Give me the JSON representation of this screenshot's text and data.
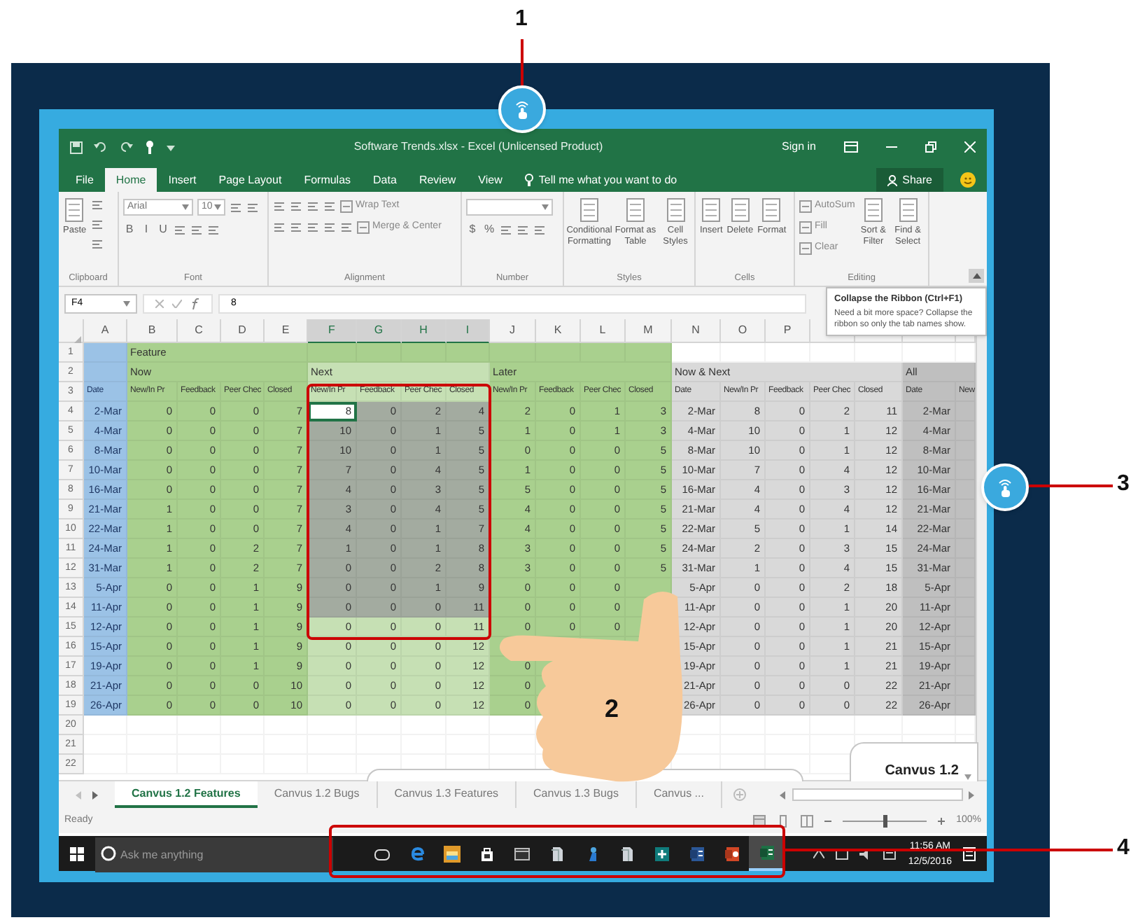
{
  "annotations": [
    {
      "label": "1",
      "kind": "button"
    },
    {
      "label": "2",
      "kind": "gesture"
    },
    {
      "label": "3",
      "kind": "button"
    },
    {
      "label": "4",
      "kind": "region"
    }
  ],
  "title_bar": {
    "title": "Software Trends.xlsx - Excel (Unlicensed Product)",
    "sign_in": "Sign in"
  },
  "ribbon_tabs": [
    {
      "label": "File",
      "selected": false
    },
    {
      "label": "Home",
      "selected": true
    },
    {
      "label": "Insert",
      "selected": false
    },
    {
      "label": "Page Layout",
      "selected": false
    },
    {
      "label": "Formulas",
      "selected": false
    },
    {
      "label": "Data",
      "selected": false
    },
    {
      "label": "Review",
      "selected": false
    },
    {
      "label": "View",
      "selected": false
    }
  ],
  "tell_me": "Tell me what you want to do",
  "share": "Share",
  "ribbon_groups": [
    {
      "label": "Clipboard",
      "items": [
        {
          "kind": "large",
          "label": "Paste"
        },
        {
          "kind": "stack",
          "lines": [
            {
              "items": [
                {
                  "kind": "icon"
                }
              ]
            },
            {
              "items": [
                {
                  "kind": "icon"
                }
              ]
            },
            {
              "items": [
                {
                  "kind": "icon"
                }
              ]
            }
          ]
        }
      ]
    },
    {
      "label": "Font",
      "items": [
        {
          "kind": "stack",
          "lines": [
            {
              "items": [
                {
                  "kind": "field",
                  "label": "Arial"
                },
                {
                  "kind": "field",
                  "label": "10"
                },
                {
                  "kind": "icon"
                },
                {
                  "kind": "icon"
                }
              ]
            },
            {
              "items": [
                {
                  "kind": "glyph",
                  "label": "B"
                },
                {
                  "kind": "glyph",
                  "label": "I"
                },
                {
                  "kind": "glyph",
                  "label": "U"
                },
                {
                  "kind": "icon"
                },
                {
                  "kind": "icon"
                },
                {
                  "kind": "icon"
                }
              ]
            }
          ]
        }
      ]
    },
    {
      "label": "Alignment",
      "items": [
        {
          "kind": "stack",
          "lines": [
            {
              "items": [
                {
                  "kind": "icon"
                },
                {
                  "kind": "icon"
                },
                {
                  "kind": "icon"
                },
                {
                  "kind": "icon"
                },
                {
                  "kind": "small",
                  "label": "Wrap Text"
                }
              ]
            },
            {
              "items": [
                {
                  "kind": "icon"
                },
                {
                  "kind": "icon"
                },
                {
                  "kind": "icon"
                },
                {
                  "kind": "icon"
                },
                {
                  "kind": "icon"
                },
                {
                  "kind": "small",
                  "label": "Merge & Center"
                }
              ]
            }
          ]
        }
      ]
    },
    {
      "label": "Number",
      "items": [
        {
          "kind": "stack",
          "lines": [
            {
              "items": [
                {
                  "kind": "field"
                }
              ]
            },
            {
              "items": [
                {
                  "kind": "glyph",
                  "label": "$"
                },
                {
                  "kind": "glyph",
                  "label": "%"
                },
                {
                  "kind": "icon"
                },
                {
                  "kind": "icon"
                },
                {
                  "kind": "icon"
                }
              ]
            }
          ]
        }
      ]
    },
    {
      "label": "Styles",
      "items": [
        {
          "kind": "large",
          "label": "Conditional Formatting"
        },
        {
          "kind": "large",
          "label": "Format as Table"
        },
        {
          "kind": "large",
          "label": "Cell Styles"
        }
      ]
    },
    {
      "label": "Cells",
      "items": [
        {
          "kind": "large",
          "label": "Insert"
        },
        {
          "kind": "large",
          "label": "Delete"
        },
        {
          "kind": "large",
          "label": "Format"
        }
      ]
    },
    {
      "label": "Editing",
      "items": [
        {
          "kind": "stack",
          "lines": [
            {
              "items": [
                {
                  "kind": "small",
                  "label": "AutoSum"
                }
              ]
            },
            {
              "items": [
                {
                  "kind": "small",
                  "label": "Fill"
                }
              ]
            },
            {
              "items": [
                {
                  "kind": "small",
                  "label": "Clear"
                }
              ]
            }
          ]
        },
        {
          "kind": "large",
          "label": "Sort & Filter"
        },
        {
          "kind": "large",
          "label": "Find & Select"
        }
      ]
    }
  ],
  "tooltip": {
    "title": "Collapse the Ribbon (Ctrl+F1)",
    "text": "Need a bit more space? Collapse the ribbon so only the tab names show."
  },
  "formula_bar": {
    "name_box": "F4",
    "value": "8"
  },
  "columns": [
    "A",
    "B",
    "C",
    "D",
    "E",
    "F",
    "G",
    "H",
    "I",
    "J",
    "K",
    "L",
    "M",
    "N",
    "O",
    "P",
    null,
    null,
    null,
    null
  ],
  "rows": [
    {
      "number": "1",
      "selected": false,
      "cells": [
        null,
        "Feature",
        null,
        null,
        null,
        null,
        null,
        null,
        null,
        null,
        null,
        null,
        null,
        null,
        null,
        null,
        null,
        null,
        null,
        null
      ]
    },
    {
      "number": "2",
      "selected": false,
      "cells": [
        null,
        "Now",
        null,
        null,
        null,
        "Next",
        null,
        null,
        null,
        "Later",
        null,
        null,
        null,
        "Now & Next",
        null,
        null,
        null,
        null,
        "All",
        null
      ]
    },
    {
      "number": "3",
      "selected": false,
      "cells": [
        "Date",
        "New/In Pr",
        "Feedback",
        "Peer Chec",
        "Closed",
        "New/In Pr",
        "Feedback",
        "Peer Chec",
        "Closed",
        "New/In Pr",
        "Feedback",
        "Peer Chec",
        "Closed",
        "Date",
        "New/In Pr",
        "Feedback",
        "Peer Chec",
        "Closed",
        "Date",
        "New"
      ]
    },
    {
      "number": "4",
      "selected": true,
      "cells": [
        "2-Mar",
        "0",
        "0",
        "0",
        "7",
        "8",
        "0",
        "2",
        "4",
        "2",
        "0",
        "1",
        "3",
        "2-Mar",
        "8",
        "0",
        "2",
        "11",
        "2-Mar",
        null
      ]
    },
    {
      "number": "5",
      "selected": true,
      "cells": [
        "4-Mar",
        "0",
        "0",
        "0",
        "7",
        "10",
        "0",
        "1",
        "5",
        "1",
        "0",
        "1",
        "3",
        "4-Mar",
        "10",
        "0",
        "1",
        "12",
        "4-Mar",
        null
      ]
    },
    {
      "number": "6",
      "selected": true,
      "cells": [
        "8-Mar",
        "0",
        "0",
        "0",
        "7",
        "10",
        "0",
        "1",
        "5",
        "0",
        "0",
        "0",
        "5",
        "8-Mar",
        "10",
        "0",
        "1",
        "12",
        "8-Mar",
        null
      ]
    },
    {
      "number": "7",
      "selected": true,
      "cells": [
        "10-Mar",
        "0",
        "0",
        "0",
        "7",
        "7",
        "0",
        "4",
        "5",
        "1",
        "0",
        "0",
        "5",
        "10-Mar",
        "7",
        "0",
        "4",
        "12",
        "10-Mar",
        null
      ]
    },
    {
      "number": "8",
      "selected": true,
      "cells": [
        "16-Mar",
        "0",
        "0",
        "0",
        "7",
        "4",
        "0",
        "3",
        "5",
        "5",
        "0",
        "0",
        "5",
        "16-Mar",
        "4",
        "0",
        "3",
        "12",
        "16-Mar",
        null
      ]
    },
    {
      "number": "9",
      "selected": true,
      "cells": [
        "21-Mar",
        "1",
        "0",
        "0",
        "7",
        "3",
        "0",
        "4",
        "5",
        "4",
        "0",
        "0",
        "5",
        "21-Mar",
        "4",
        "0",
        "4",
        "12",
        "21-Mar",
        null
      ]
    },
    {
      "number": "10",
      "selected": true,
      "cells": [
        "22-Mar",
        "1",
        "0",
        "0",
        "7",
        "4",
        "0",
        "1",
        "7",
        "4",
        "0",
        "0",
        "5",
        "22-Mar",
        "5",
        "0",
        "1",
        "14",
        "22-Mar",
        null
      ]
    },
    {
      "number": "11",
      "selected": true,
      "cells": [
        "24-Mar",
        "1",
        "0",
        "2",
        "7",
        "1",
        "0",
        "1",
        "8",
        "3",
        "0",
        "0",
        "5",
        "24-Mar",
        "2",
        "0",
        "3",
        "15",
        "24-Mar",
        null
      ]
    },
    {
      "number": "12",
      "selected": true,
      "cells": [
        "31-Mar",
        "1",
        "0",
        "2",
        "7",
        "0",
        "0",
        "2",
        "8",
        "3",
        "0",
        "0",
        "5",
        "31-Mar",
        "1",
        "0",
        "4",
        "15",
        "31-Mar",
        null
      ]
    },
    {
      "number": "13",
      "selected": true,
      "cells": [
        "5-Apr",
        "0",
        "0",
        "1",
        "9",
        "0",
        "0",
        "1",
        "9",
        "0",
        "0",
        "0",
        null,
        "5-Apr",
        "0",
        "0",
        "2",
        "18",
        "5-Apr",
        null
      ]
    },
    {
      "number": "14",
      "selected": true,
      "cells": [
        "11-Apr",
        "0",
        "0",
        "1",
        "9",
        "0",
        "0",
        "0",
        "11",
        "0",
        "0",
        "0",
        null,
        "11-Apr",
        "0",
        "0",
        "1",
        "20",
        "11-Apr",
        null
      ]
    },
    {
      "number": "15",
      "selected": false,
      "cells": [
        "12-Apr",
        "0",
        "0",
        "1",
        "9",
        "0",
        "0",
        "0",
        "11",
        "0",
        "0",
        "0",
        null,
        "12-Apr",
        "0",
        "0",
        "1",
        "20",
        "12-Apr",
        null
      ]
    },
    {
      "number": "16",
      "selected": false,
      "cells": [
        "15-Apr",
        "0",
        "0",
        "1",
        "9",
        "0",
        "0",
        "0",
        "12",
        null,
        null,
        null,
        null,
        "15-Apr",
        "0",
        "0",
        "1",
        "21",
        "15-Apr",
        null
      ]
    },
    {
      "number": "17",
      "selected": false,
      "cells": [
        "19-Apr",
        "0",
        "0",
        "1",
        "9",
        "0",
        "0",
        "0",
        "12",
        "0",
        null,
        null,
        null,
        "19-Apr",
        "0",
        "0",
        "1",
        "21",
        "19-Apr",
        null
      ]
    },
    {
      "number": "18",
      "selected": false,
      "cells": [
        "21-Apr",
        "0",
        "0",
        "0",
        "10",
        "0",
        "0",
        "0",
        "12",
        "0",
        null,
        null,
        null,
        "21-Apr",
        "0",
        "0",
        "0",
        "22",
        "21-Apr",
        null
      ]
    },
    {
      "number": "19",
      "selected": false,
      "cells": [
        "26-Apr",
        "0",
        "0",
        "0",
        "10",
        "0",
        "0",
        "0",
        "12",
        "0",
        null,
        null,
        null,
        "26-Apr",
        "0",
        "0",
        "0",
        "22",
        "26-Apr",
        null
      ]
    },
    {
      "number": "20",
      "selected": false,
      "cells": [
        null,
        null,
        null,
        null,
        null,
        null,
        null,
        null,
        null,
        null,
        null,
        null,
        null,
        null,
        null,
        null,
        null,
        null,
        null,
        null
      ]
    },
    {
      "number": "21",
      "selected": false,
      "cells": [
        null,
        null,
        null,
        null,
        null,
        null,
        null,
        null,
        null,
        null,
        null,
        null,
        null,
        null,
        null,
        null,
        null,
        null,
        null,
        null
      ]
    },
    {
      "number": "22",
      "selected": false,
      "cells": [
        null,
        null,
        null,
        null,
        null,
        null,
        null,
        null,
        null,
        null,
        null,
        null,
        null,
        null,
        null,
        null,
        null,
        null,
        null,
        null
      ]
    }
  ],
  "chart_title": "Canvus 1.2",
  "sheet_tabs": [
    {
      "label": "Canvus 1.2 Features",
      "selected": true
    },
    {
      "label": "Canvus 1.2 Bugs",
      "selected": false
    },
    {
      "label": "Canvus 1.3 Features",
      "selected": false
    },
    {
      "label": "Canvus 1.3 Bugs",
      "selected": false
    },
    {
      "label": "Canvus ...",
      "selected": false
    }
  ],
  "status_bar": {
    "status": "Ready",
    "zoom": {
      "level": 0.5,
      "reading": "100%"
    }
  },
  "taskbar": {
    "search": {
      "placeholder": "Ask me anything"
    },
    "apps": [
      {
        "kind": "task_view",
        "active": false
      },
      {
        "kind": "browser",
        "active": false
      },
      {
        "kind": "folder",
        "active": false
      },
      {
        "kind": "store",
        "active": false
      },
      {
        "kind": "window",
        "active": false
      },
      {
        "kind": "document",
        "active": false
      },
      {
        "kind": "figure",
        "active": false
      },
      {
        "kind": "document",
        "active": false
      },
      {
        "kind": "publisher",
        "active": false
      },
      {
        "kind": "word",
        "active": false
      },
      {
        "kind": "powerpoint",
        "active": false
      },
      {
        "kind": "spreadsheet",
        "active": true
      }
    ],
    "time": "11:56 AM",
    "date": "12/5/2016"
  }
}
